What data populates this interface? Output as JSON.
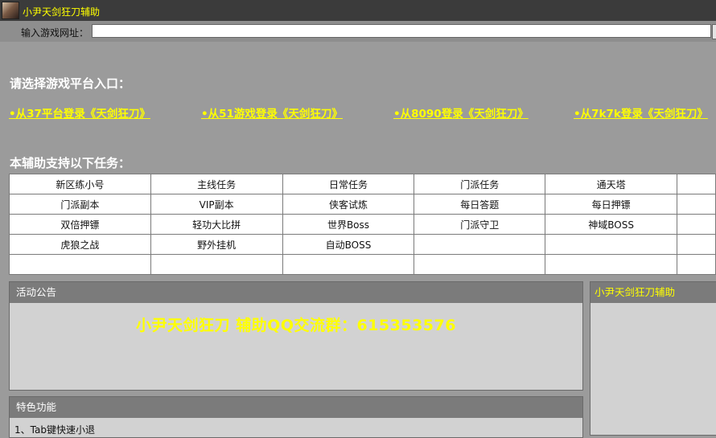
{
  "window": {
    "title": "小尹天剑狂刀辅助"
  },
  "url_bar": {
    "label": "输入游戏网址：",
    "value": ""
  },
  "platform": {
    "heading": "请选择游戏平台入口：",
    "links": [
      "•从37平台登录《天剑狂刀》",
      "•从51游戏登录《天剑狂刀》",
      "•从8090登录《天剑狂刀》",
      "•从7k7k登录《天剑狂刀》"
    ]
  },
  "tasks": {
    "heading": "本辅助支持以下任务：",
    "rows": [
      [
        "新区练小号",
        "主线任务",
        "日常任务",
        "门派任务",
        "通天塔",
        ""
      ],
      [
        "门派副本",
        "VIP副本",
        "侠客试炼",
        "每日答题",
        "每日押镖",
        ""
      ],
      [
        "双倍押镖",
        "轻功大比拼",
        "世界Boss",
        "门派守卫",
        "神域BOSS",
        ""
      ],
      [
        "虎狼之战",
        "野外挂机",
        "自动BOSS",
        "",
        "",
        ""
      ],
      [
        "",
        "",
        "",
        "",
        "",
        ""
      ]
    ]
  },
  "announcement": {
    "title": "活动公告",
    "message": "小尹天剑狂刀 辅助QQ交流群：615353576"
  },
  "features": {
    "title": "特色功能",
    "first_item": "1、Tab键快速小退"
  },
  "side_panel": {
    "title": "小尹天剑狂刀辅助"
  },
  "colors": {
    "accent": "#ffff00",
    "titlebar": "#3b3b3b",
    "background": "#9b9b9b"
  }
}
